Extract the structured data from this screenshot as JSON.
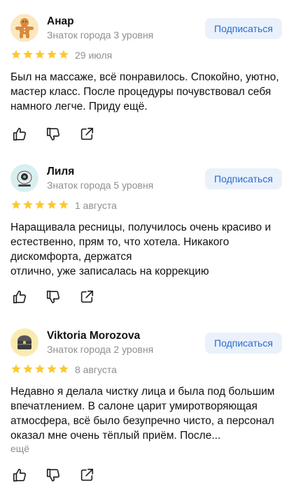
{
  "reviews": [
    {
      "author": "Анар",
      "level": "Знаток города 3 уровня",
      "subscribe_label": "Подписаться",
      "rating": 5,
      "date": "29 июля",
      "text_lines": [
        "Был на массаже, всё понравилось. Спокойно, уютно, мастер класс. После процедуры почувствовал себя намного легче. Приду ещё."
      ],
      "more_label": "",
      "avatar_icon": "gingerbread-icon"
    },
    {
      "author": "Лиля",
      "level": "Знаток города 5 уровня",
      "subscribe_label": "Подписаться",
      "rating": 5,
      "date": "1 августа",
      "text_lines": [
        "Наращивала ресницы, получилось очень красиво и естественно, прям то, что хотела. Никакого дискомфорта, держатся",
        "отлично, уже записалась на коррекцию"
      ],
      "more_label": "",
      "avatar_icon": "robot-icon"
    },
    {
      "author": "Viktoria Morozova",
      "level": "Знаток города 2 уровня",
      "subscribe_label": "Подписаться",
      "rating": 5,
      "date": "8 августа",
      "text_lines": [
        "Недавно я делала чистку лица и была под большим впечатлением. В салоне царит умиротворяющая атмосфера, всё было безупречно чисто, а персонал оказал мне очень тёплый приём. После..."
      ],
      "more_label": "ещё",
      "avatar_icon": "treasure-chest-icon"
    }
  ],
  "colors": {
    "star": "#fcc82f",
    "accent": "#2a6bd0",
    "button_bg": "#eaf1fb",
    "muted": "#8f8f8f"
  }
}
